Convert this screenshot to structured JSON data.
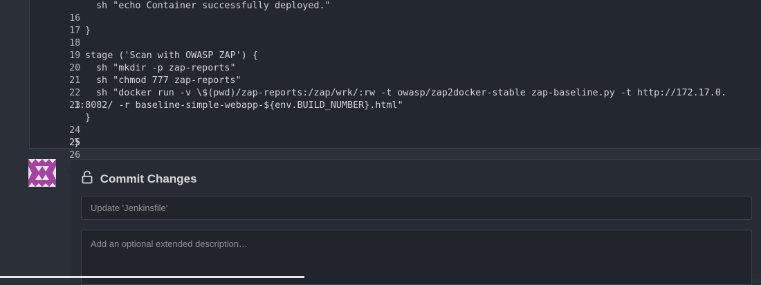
{
  "editor": {
    "lines": [
      {
        "num": "16",
        "code": "sh \"echo Container successfully deployed.\"",
        "indent": 1
      },
      {
        "num": "17",
        "code": "",
        "indent": 0
      },
      {
        "num": "18",
        "code": "}",
        "indent": 0
      },
      {
        "num": "19",
        "code": "",
        "indent": 0
      },
      {
        "num": "20",
        "code": "stage ('Scan with OWASP ZAP') {",
        "indent": 0
      },
      {
        "num": "21",
        "code": "sh \"mkdir -p zap-reports\"",
        "indent": 1
      },
      {
        "num": "22",
        "code": "sh \"chmod 777 zap-reports\"",
        "indent": 1
      },
      {
        "num": "23",
        "code": "sh \"docker run -v \\$(pwd)/zap-reports:/zap/wrk/:rw -t owasp/zap2docker-stable zap-baseline.py -t http://172.17.0.",
        "indent": 1
      },
      {
        "num": "",
        "code": "1:8082/ -r baseline-simple-webapp-${env.BUILD_NUMBER}.html\"",
        "indent": -1
      },
      {
        "num": "24",
        "code": "}",
        "indent": 0
      },
      {
        "num": "25",
        "code": "",
        "indent": 0
      },
      {
        "num": "26",
        "code": "}",
        "indent": -2
      }
    ]
  },
  "commit": {
    "title": "Commit Changes",
    "summary_placeholder": "Update 'Jenkinsfile'",
    "description_placeholder": "Add an optional extended description…"
  },
  "colors": {
    "avatar": "#9b3f9e",
    "editor_bg": "#23272e",
    "page_bg": "#2b2f38"
  },
  "icons": {
    "commit_title_icon": "unlocked-padlock-icon",
    "avatar": "identicon"
  }
}
